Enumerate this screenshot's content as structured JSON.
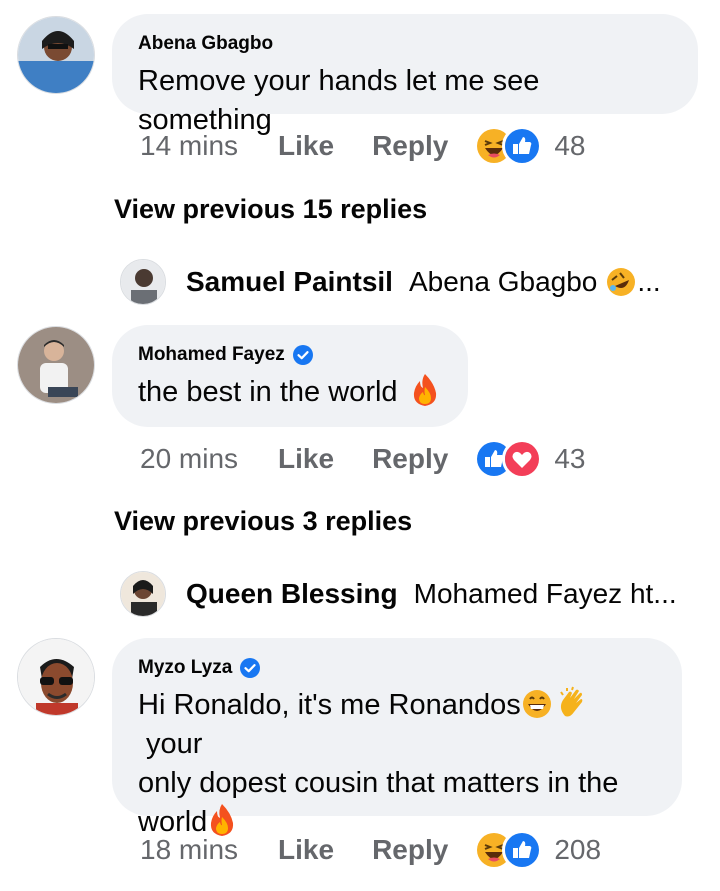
{
  "comments": [
    {
      "author": "Abena Gbagbo",
      "verified": false,
      "text": "Remove your hands let me see something",
      "time": "14 mins",
      "like_label": "Like",
      "reply_label": "Reply",
      "reactions": [
        "haha",
        "like"
      ],
      "reaction_count": "48"
    },
    {
      "author": "Mohamed Fayez",
      "verified": true,
      "text": "the best in the world",
      "time": "20 mins",
      "like_label": "Like",
      "reply_label": "Reply",
      "reactions": [
        "like",
        "love"
      ],
      "reaction_count": "43"
    },
    {
      "author": "Myzo Lyza",
      "verified": true,
      "text_line1": "Hi Ronaldo, it's me Ronandos",
      "text_line1_end": "your",
      "text_line2": "only dopest cousin that matters in the",
      "text_line3": "world",
      "time": "18 mins",
      "like_label": "Like",
      "reply_label": "Reply",
      "reactions": [
        "haha",
        "like"
      ],
      "reaction_count": "208"
    }
  ],
  "view_previous": [
    {
      "label": "View previous 15 replies"
    },
    {
      "label": "View previous 3 replies"
    }
  ],
  "replies": [
    {
      "author": "Samuel Paintsil",
      "text": "Abena Gbagbo",
      "suffix": "..."
    },
    {
      "author": "Queen Blessing",
      "text": "Mohamed Fayez ht..."
    }
  ],
  "colors": {
    "bubble": "#f0f2f5",
    "meta": "#65676b",
    "like_blue": "#1877f2",
    "love_red": "#f33e58",
    "verified_blue": "#1877f2"
  }
}
